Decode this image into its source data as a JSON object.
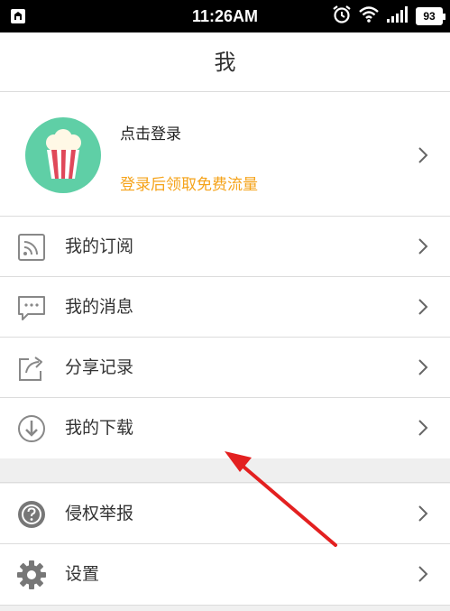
{
  "status_bar": {
    "time": "11:26AM",
    "battery": "93",
    "icons": [
      "notification-icon",
      "alarm-icon",
      "wifi-icon",
      "signal-icon",
      "battery-icon"
    ]
  },
  "header": {
    "title": "我"
  },
  "profile": {
    "login_label": "点击登录",
    "login_promo": "登录后领取免费流量",
    "promo_color": "#f5a31a",
    "avatar_color": "#5fcfa6"
  },
  "menu_group_1": [
    {
      "label": "我的订阅",
      "icon": "subscription-icon"
    },
    {
      "label": "我的消息",
      "icon": "message-icon"
    },
    {
      "label": "分享记录",
      "icon": "share-icon"
    },
    {
      "label": "我的下载",
      "icon": "download-icon"
    }
  ],
  "menu_group_2": [
    {
      "label": "侵权举报",
      "icon": "help-icon"
    },
    {
      "label": "设置",
      "icon": "gear-icon"
    }
  ],
  "annotation": {
    "color": "#e32020"
  }
}
